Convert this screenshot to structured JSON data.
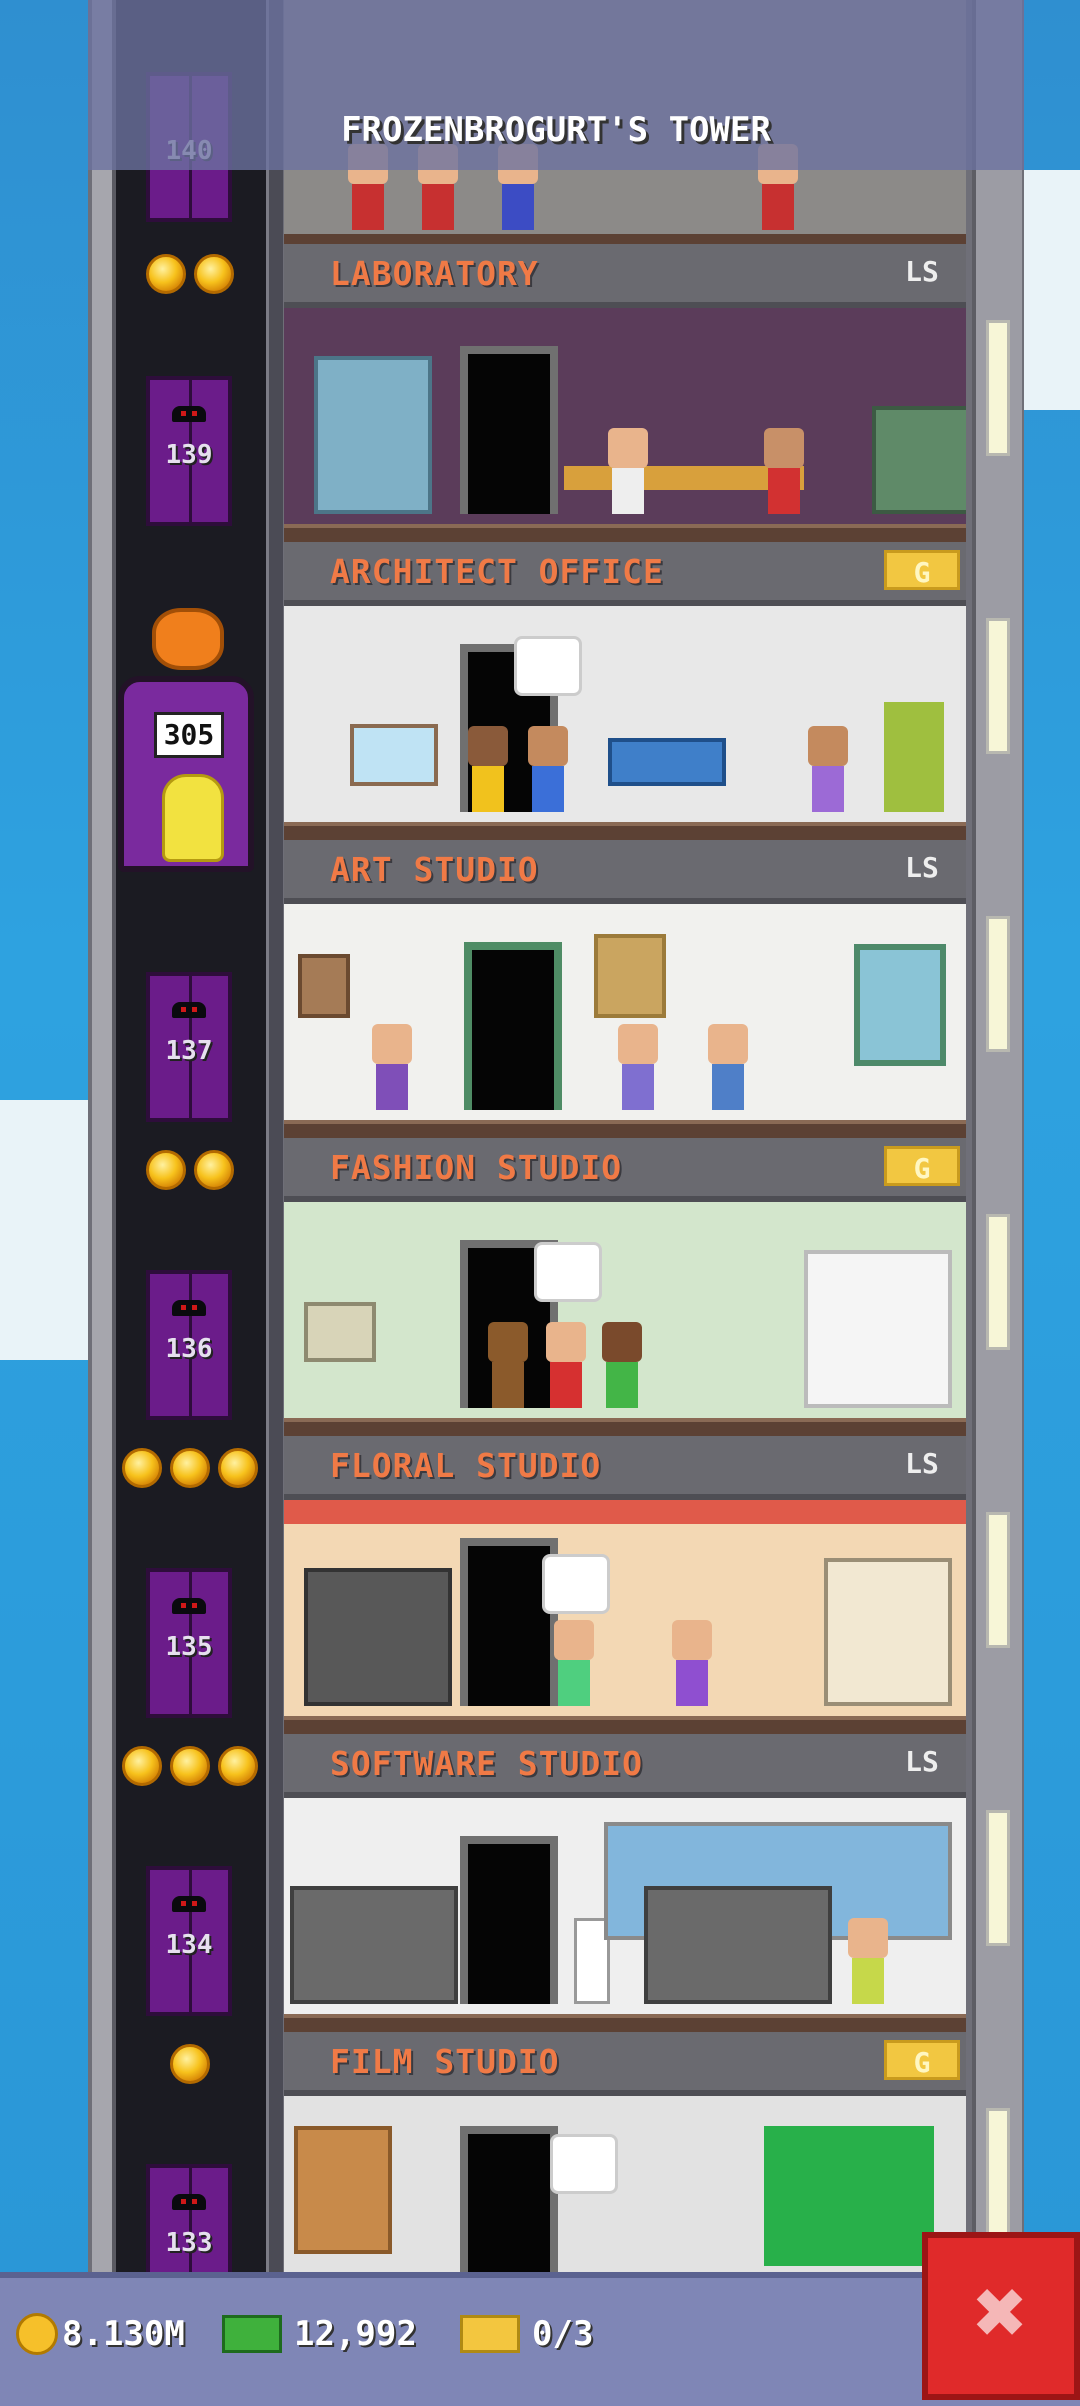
{
  "header": {
    "title": "FROZENBROGURT'S TOWER"
  },
  "elevator": {
    "cars": [
      {
        "label": "140"
      },
      {
        "label": "139"
      },
      {
        "label": "137"
      },
      {
        "label": "136"
      },
      {
        "label": "135"
      },
      {
        "label": "134"
      },
      {
        "label": "133"
      }
    ],
    "current_car": {
      "display": "305"
    }
  },
  "floors": [
    {
      "name": "LABORATORY",
      "tag": "LS",
      "tag_style": "ls",
      "coins": 2
    },
    {
      "name": "ARCHITECT OFFICE",
      "tag": "G",
      "tag_style": "g",
      "coins": 0
    },
    {
      "name": "ART STUDIO",
      "tag": "LS",
      "tag_style": "ls",
      "coins": 0
    },
    {
      "name": "FASHION STUDIO",
      "tag": "G",
      "tag_style": "g",
      "coins": 2
    },
    {
      "name": "FLORAL STUDIO",
      "tag": "LS",
      "tag_style": "ls",
      "coins": 3
    },
    {
      "name": "SOFTWARE STUDIO",
      "tag": "LS",
      "tag_style": "ls",
      "coins": 3
    },
    {
      "name": "FILM STUDIO",
      "tag": "G",
      "tag_style": "g",
      "coins": 1
    }
  ],
  "footer": {
    "coins": "8.130M",
    "bux": "12,992",
    "tickets": "0/3",
    "close_icon": "close-icon"
  },
  "colors": {
    "sky": "#2ea2e0",
    "label": "#f07a46",
    "elevator_door": "#6b1c8a",
    "close_button": "#e02a2a"
  }
}
